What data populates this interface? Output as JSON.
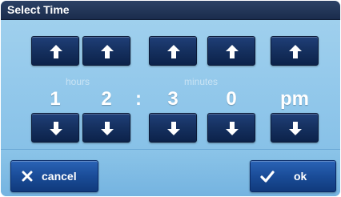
{
  "window": {
    "title": "Select Time"
  },
  "picker": {
    "hours_label": "hours",
    "minutes_label": "minutes",
    "separator": ":",
    "hour_tens": "1",
    "hour_ones": "2",
    "minute_tens": "3",
    "minute_ones": "0",
    "meridiem": "pm",
    "up_icon": "arrow-up-icon",
    "down_icon": "arrow-down-icon"
  },
  "actions": {
    "cancel_label": "cancel",
    "cancel_icon": "close-icon",
    "ok_label": "ok",
    "ok_icon": "checkmark-icon"
  },
  "colors": {
    "titlebar": "#1f3356",
    "background": "#92c9ec",
    "button": "#15305f",
    "action_button": "#1a4c98",
    "text": "#ffffff"
  }
}
